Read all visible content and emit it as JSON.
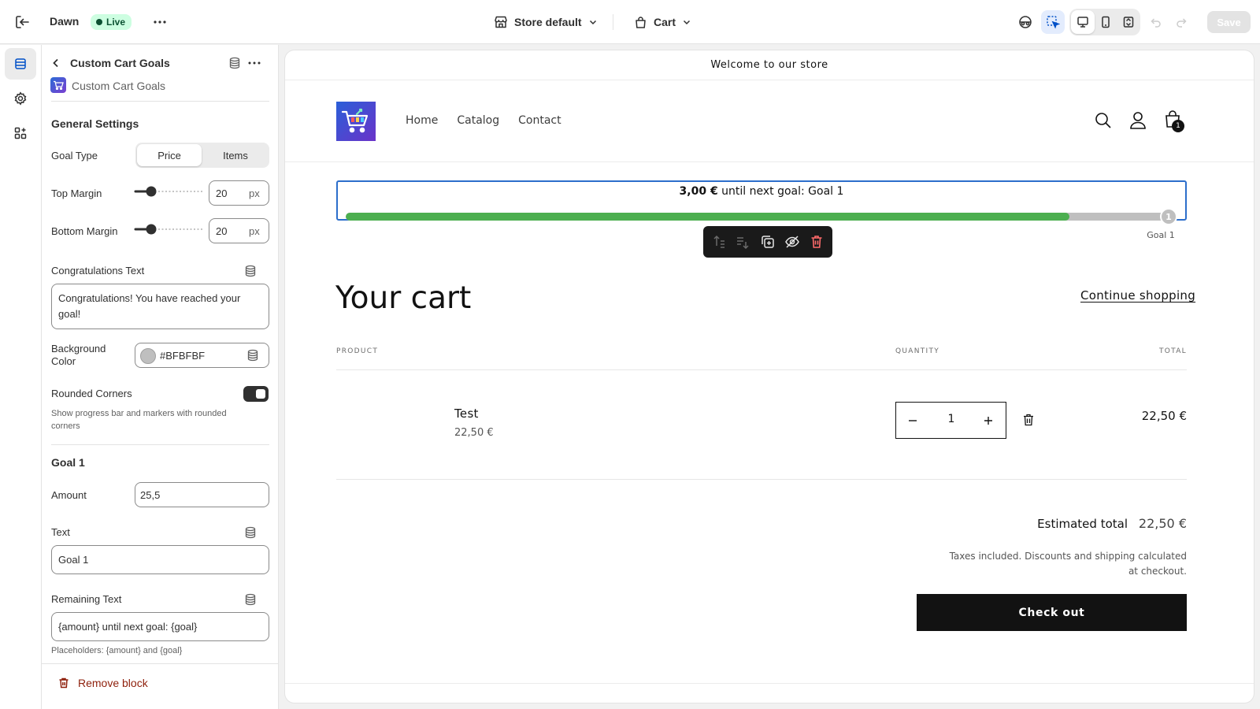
{
  "topbar": {
    "theme_name": "Dawn",
    "status_badge": "Live",
    "store_selector": "Store default",
    "template_selector": "Cart",
    "save_label": "Save"
  },
  "panel": {
    "header_title": "Custom Cart Goals",
    "app_name": "Custom Cart Goals",
    "general_heading": "General Settings",
    "goal_type": {
      "label": "Goal Type",
      "options": [
        "Price",
        "Items"
      ],
      "selected": "Price"
    },
    "top_margin": {
      "label": "Top Margin",
      "value": "20",
      "unit": "px",
      "slider_fraction": 0.2
    },
    "bottom_margin": {
      "label": "Bottom Margin",
      "value": "20",
      "unit": "px",
      "slider_fraction": 0.2
    },
    "congrats": {
      "label": "Congratulations Text",
      "value": "Congratulations! You have reached your goal!"
    },
    "bg_color": {
      "label": "Background Color",
      "value": "#BFBFBF",
      "swatch": "#BFBFBF"
    },
    "rounded": {
      "label": "Rounded Corners",
      "help": "Show progress bar and markers with rounded corners",
      "enabled": true
    },
    "goal1_heading": "Goal 1",
    "amount": {
      "label": "Amount",
      "value": "25,5"
    },
    "text": {
      "label": "Text",
      "value": "Goal 1"
    },
    "remaining": {
      "label": "Remaining Text",
      "value": "{amount} until next goal: {goal}",
      "help": "Placeholders: {amount} and {goal}"
    },
    "remove_label": "Remove block"
  },
  "store": {
    "announcement": "Welcome to our store",
    "nav": [
      "Home",
      "Catalog",
      "Contact"
    ],
    "cart_count": "1",
    "goal_bar": {
      "amount_text": "3,00 €",
      "rest_text": " until next goal: Goal 1",
      "progress_fraction": 0.88,
      "marker_number": "1",
      "marker_label": "Goal 1",
      "fill_color": "#4caf50",
      "track_color": "#bfbfbf"
    },
    "cart_title": "Your cart",
    "continue_link": "Continue shopping",
    "columns": {
      "product": "PRODUCT",
      "quantity": "QUANTITY",
      "total": "TOTAL"
    },
    "item": {
      "name": "Test",
      "price": "22,50 €",
      "quantity": "1",
      "total": "22,50 €"
    },
    "estimated_label": "Estimated total",
    "estimated_value": "22,50 €",
    "tax_note": "Taxes included. Discounts and shipping calculated at checkout.",
    "checkout_label": "Check out"
  }
}
